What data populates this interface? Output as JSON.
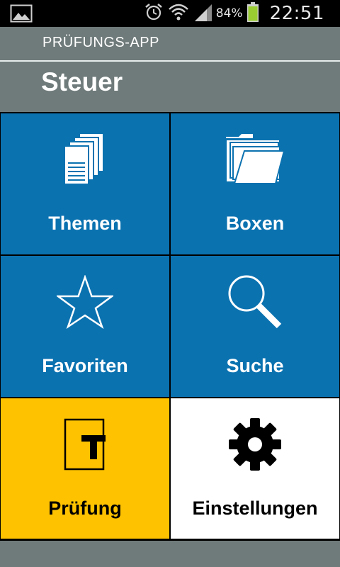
{
  "status_bar": {
    "battery_percent": "84%",
    "time": "22:51",
    "icons": [
      "gallery-icon",
      "alarm-icon",
      "wifi-icon",
      "signal-icon",
      "battery-icon"
    ]
  },
  "header": {
    "app_name": "PRÜFUNGS-APP",
    "title": "Steuer"
  },
  "tiles": [
    {
      "label": "Themen",
      "icon": "documents-icon",
      "color": "#0b72b0"
    },
    {
      "label": "Boxen",
      "icon": "folder-icon",
      "color": "#0b72b0"
    },
    {
      "label": "Favoriten",
      "icon": "star-icon",
      "color": "#0b72b0"
    },
    {
      "label": "Suche",
      "icon": "search-icon",
      "color": "#0b72b0"
    },
    {
      "label": "Prüfung",
      "icon": "exam-icon",
      "color": "#ffc200"
    },
    {
      "label": "Einstellungen",
      "icon": "gear-icon",
      "color": "#ffffff"
    }
  ],
  "colors": {
    "header_bg": "#6f7a7a",
    "tile_blue": "#0b72b0",
    "tile_yellow": "#ffc200",
    "battery_green": "#9acd32"
  }
}
